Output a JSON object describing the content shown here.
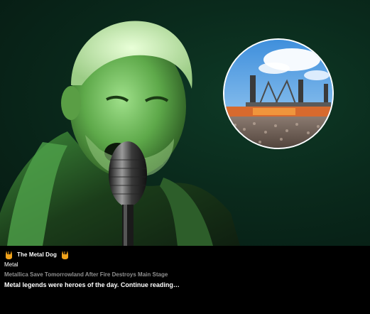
{
  "post": {
    "source_name": "The Metal Dog",
    "source_icon": "metal-horns-hand-icon",
    "category": "Metal",
    "headline": "Metallica Save Tomorrowland After Fire Destroys Main Stage",
    "teaser": "Metal legends were heroes of the day. Continue reading…"
  },
  "images": {
    "main_photo": "singer-at-microphone-green-light",
    "inset_photo": "festival-stage-crowd"
  },
  "colors": {
    "background": "#000000",
    "hero_green": "#0a2a1c",
    "headline_grey": "#8f8f8f",
    "text": "#ffffff"
  }
}
